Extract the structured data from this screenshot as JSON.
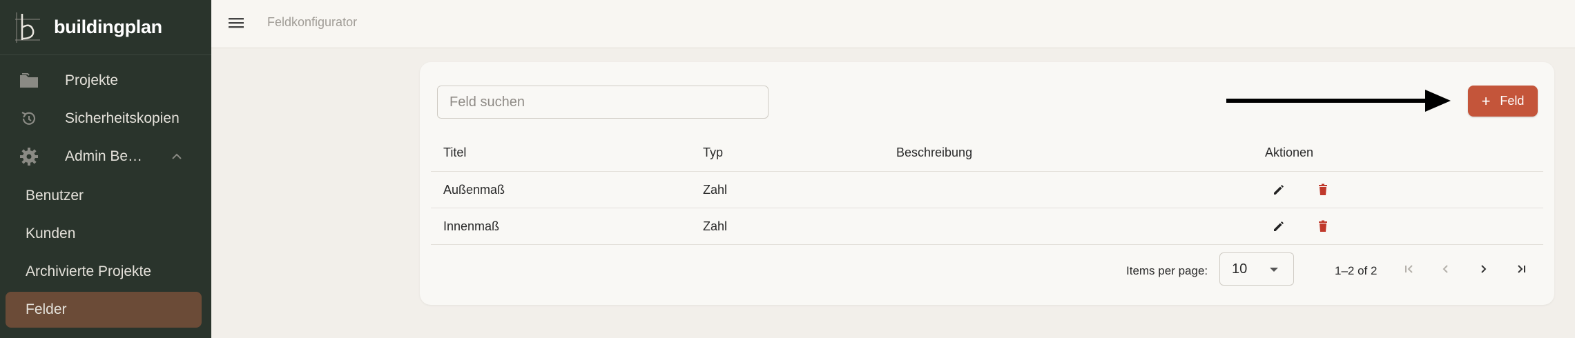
{
  "app": {
    "name": "buildingplan"
  },
  "sidebar": {
    "items": [
      {
        "label": "Projekte",
        "icon": "folder-icon"
      },
      {
        "label": "Sicherheitskopien",
        "icon": "restore-icon"
      },
      {
        "label": "Admin Be…",
        "icon": "gear-icon",
        "expanded": true
      }
    ],
    "subitems": [
      {
        "label": "Benutzer"
      },
      {
        "label": "Kunden"
      },
      {
        "label": "Archivierte Projekte"
      },
      {
        "label": "Felder",
        "active": true
      }
    ]
  },
  "topbar": {
    "title": "Feldkonfigurator"
  },
  "search": {
    "placeholder": "Feld suchen",
    "value": ""
  },
  "add_button": {
    "label": "Feld"
  },
  "table": {
    "headers": {
      "title": "Titel",
      "typ": "Typ",
      "desc": "Beschreibung",
      "actions": "Aktionen"
    },
    "rows": [
      {
        "title": "Außenmaß",
        "typ": "Zahl",
        "desc": ""
      },
      {
        "title": "Innenmaß",
        "typ": "Zahl",
        "desc": ""
      }
    ]
  },
  "pager": {
    "items_per_page_label": "Items per page:",
    "items_per_page": "10",
    "range": "1–2 of 2"
  },
  "colors": {
    "sidebar": "#2a342c",
    "active": "#6b4b37",
    "accent": "#c4553a",
    "delete": "#c0392b"
  }
}
